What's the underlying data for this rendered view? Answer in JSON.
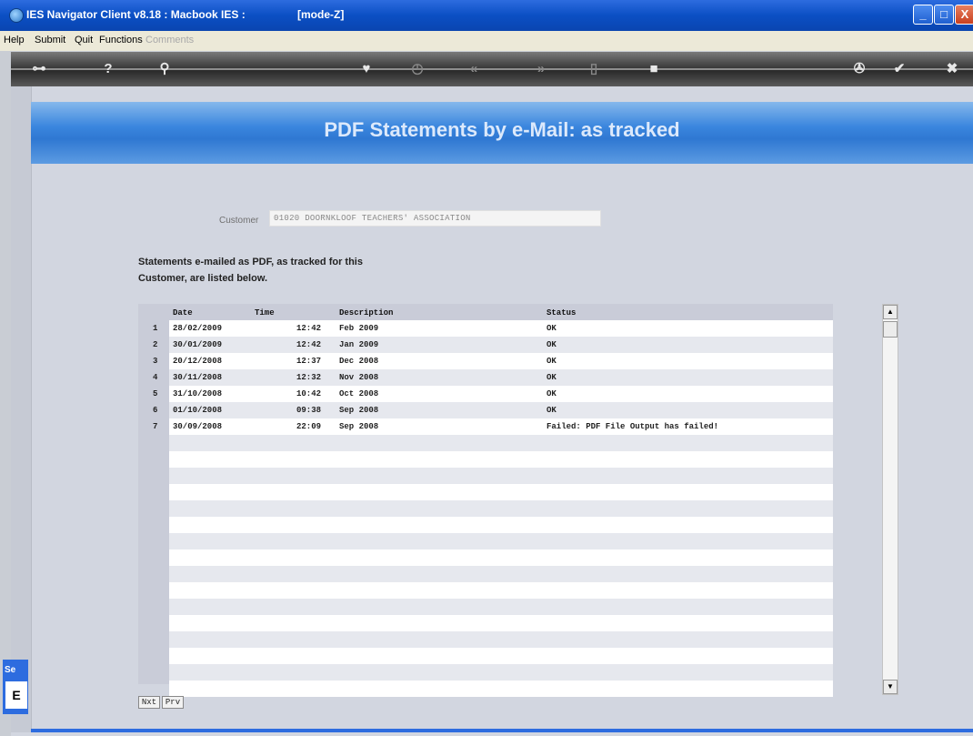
{
  "window": {
    "title": "IES Navigator Client v8.18 : Macbook IES :",
    "mode": "[mode-Z]",
    "min_glyph": "_",
    "max_glyph": "□",
    "close_glyph": "X"
  },
  "menu": {
    "items": [
      "Help",
      "Submit",
      "Quit",
      "Functions",
      "Comments"
    ]
  },
  "toolbar": {
    "icons": [
      "key-icon",
      "help-icon",
      "search-icon",
      "heart-icon",
      "clock-icon",
      "rewind-icon",
      "fast-forward-icon",
      "stop-icon",
      "clipboard-icon",
      "ok-icon",
      "cancel-icon"
    ]
  },
  "page": {
    "title": "PDF Statements by e-Mail: as tracked",
    "customer_label": "Customer",
    "customer_value": "01020 DOORNKLOOF TEACHERS' ASSOCIATION",
    "info_line1": "Statements e-mailed as PDF, as tracked for this",
    "info_line2": "Customer, are listed below."
  },
  "grid": {
    "headers": {
      "date": "Date",
      "time": "Time",
      "description": "Description",
      "status": "Status"
    },
    "rows": [
      {
        "n": "1",
        "date": "28/02/2009",
        "time": "12:42",
        "description": "Feb 2009",
        "status": "OK"
      },
      {
        "n": "2",
        "date": "30/01/2009",
        "time": "12:42",
        "description": "Jan 2009",
        "status": "OK"
      },
      {
        "n": "3",
        "date": "20/12/2008",
        "time": "12:37",
        "description": "Dec 2008",
        "status": "OK"
      },
      {
        "n": "4",
        "date": "30/11/2008",
        "time": "12:32",
        "description": "Nov 2008",
        "status": "OK"
      },
      {
        "n": "5",
        "date": "31/10/2008",
        "time": "10:42",
        "description": "Oct 2008",
        "status": "OK"
      },
      {
        "n": "6",
        "date": "01/10/2008",
        "time": "09:38",
        "description": "Sep 2008",
        "status": "OK"
      },
      {
        "n": "7",
        "date": "30/09/2008",
        "time": "22:09",
        "description": "Sep 2008",
        "status": "Failed: PDF File Output has failed!"
      }
    ]
  },
  "buttons": {
    "next": "Nxt",
    "prev": "Prv"
  },
  "side": {
    "tab_text": "Se",
    "box_text": "E"
  }
}
